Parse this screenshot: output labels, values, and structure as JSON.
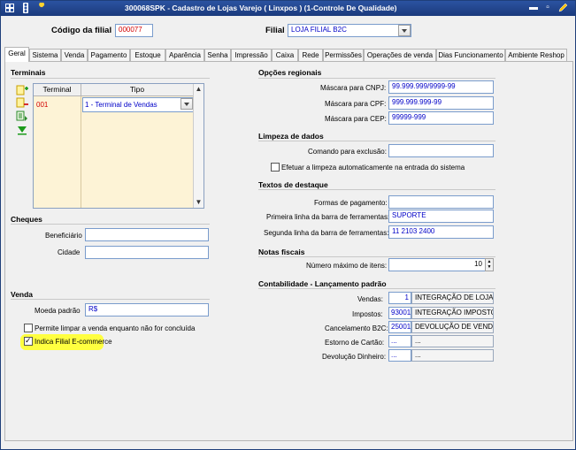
{
  "window": {
    "title": "300068SPK - Cadastro de Lojas Varejo ( Linxpos ) (1-Controle De Qualidade)",
    "icons": [
      "grid-app-icon",
      "traffic-light-icon",
      "wrench-icon"
    ],
    "buttons": {
      "minimize": "▬",
      "restore": "▫",
      "close": "✕"
    }
  },
  "header": {
    "codigo_label": "Código da filial",
    "codigo_value": "000077",
    "filial_label": "Filial",
    "filial_value": "LOJA FILIAL B2C"
  },
  "tabs": [
    {
      "label": "Geral",
      "active": true
    },
    {
      "label": "Sistema"
    },
    {
      "label": "Venda"
    },
    {
      "label": "Pagamento"
    },
    {
      "label": "Estoque"
    },
    {
      "label": "Aparência"
    },
    {
      "label": "Senha"
    },
    {
      "label": "Impressão"
    },
    {
      "label": "Caixa"
    },
    {
      "label": "Rede"
    },
    {
      "label": "Permissões"
    },
    {
      "label": "Operações de venda"
    },
    {
      "label": "Dias Funcionamento"
    },
    {
      "label": "Ambiente Reshop"
    }
  ],
  "terminais": {
    "title": "Terminais",
    "col_terminal": "Terminal",
    "col_tipo": "Tipo",
    "rows": [
      {
        "terminal": "001",
        "tipo": "1 - Terminal de Vendas"
      }
    ]
  },
  "cheques": {
    "title": "Cheques",
    "beneficiario_label": "Beneficiário",
    "beneficiario_value": "",
    "cidade_label": "Cidade",
    "cidade_value": ""
  },
  "venda": {
    "title": "Venda",
    "moeda_label": "Moeda padrão",
    "moeda_value": "R$",
    "permite_label": "Permite limpar a venda enquanto não for concluída",
    "indica_label": "Indica Filial E-commerce"
  },
  "opcoes": {
    "title": "Opções regionais",
    "cnpj_label": "Máscara para CNPJ:",
    "cnpj_value": "99.999.999/9999-99",
    "cpf_label": "Máscara para CPF:",
    "cpf_value": "999.999.999-99",
    "cep_label": "Máscara para CEP:",
    "cep_value": "99999-999"
  },
  "limpeza": {
    "title": "Limpeza de dados",
    "comando_label": "Comando para exclusão:",
    "comando_value": "",
    "efetuar_label": "Efetuar a limpeza automaticamente na entrada do sistema"
  },
  "destaque": {
    "title": "Textos de destaque",
    "formas_label": "Formas de pagamento:",
    "formas_value": "",
    "primeira_label": "Primeira linha da barra de ferramentas:",
    "primeira_value": "SUPORTE",
    "segunda_label": "Segunda linha da barra de ferramentas:",
    "segunda_value": "11 2103 2400"
  },
  "notas": {
    "title": "Notas fiscais",
    "numero_label": "Número máximo de itens:",
    "numero_value": "10"
  },
  "contabilidade": {
    "title": "Contabilidade - Lançamento padrão",
    "vendas_label": "Vendas:",
    "vendas_code": "1",
    "vendas_desc": "INTEGRAÇÃO DE LOJAS",
    "impostos_label": "Impostos:",
    "impostos_code": "93001",
    "impostos_desc": "INTEGRAÇÃO IMPOSTOS -",
    "cancelamento_label": "Cancelamento B2C:",
    "cancelamento_code": "25001",
    "cancelamento_desc": "DEVOLUÇÃO DE VENDA",
    "estorno_label": "Estorno de Cartão:",
    "estorno_code": "...",
    "estorno_desc": "...",
    "devolucao_label": "Devolução Dinheiro:",
    "devolucao_code": "...",
    "devolucao_desc": "..."
  }
}
